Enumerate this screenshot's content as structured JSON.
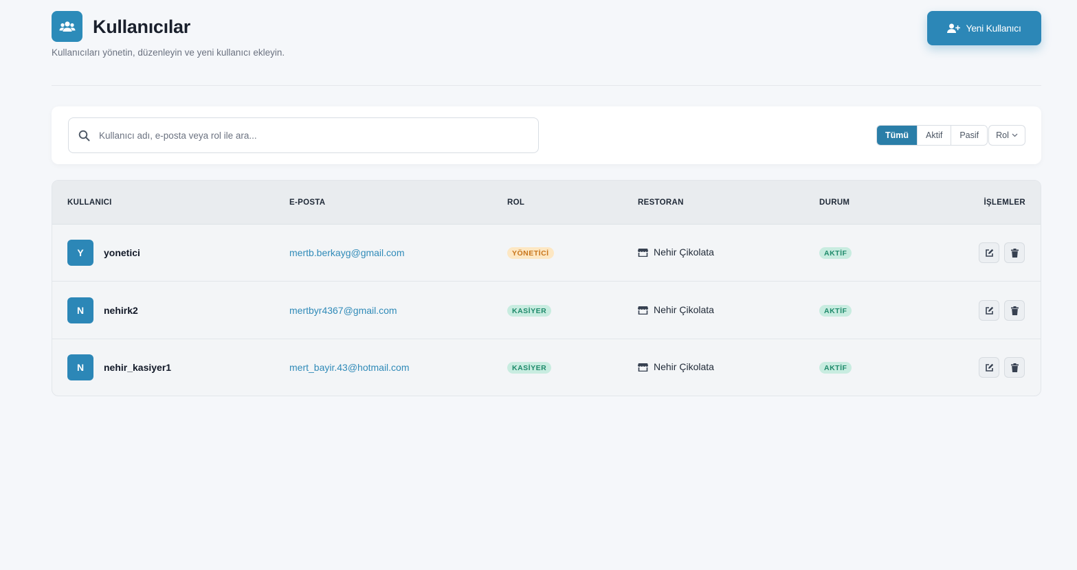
{
  "header": {
    "title": "Kullanıcılar",
    "subtitle": "Kullanıcıları yönetin, düzenleyin ve yeni kullanıcı ekleyin.",
    "icon": "users-icon",
    "new_user_label": "Yeni Kullanıcı"
  },
  "search": {
    "placeholder": "Kullanıcı adı, e-posta veya rol ile ara...",
    "value": ""
  },
  "filters": {
    "status": [
      "Tümü",
      "Aktif",
      "Pasif"
    ],
    "active_status": "Tümü",
    "role_label": "Rol"
  },
  "table": {
    "columns": [
      "KULLANICI",
      "E-POSTA",
      "ROL",
      "RESTORAN",
      "DURUM",
      "İŞLEMLER"
    ],
    "rows": [
      {
        "initial": "Y",
        "username": "yonetici",
        "email": "mertb.berkayg@gmail.com",
        "role": "YÖNETİCİ",
        "restaurant": "Nehir Çikolata",
        "status": "AKTİF"
      },
      {
        "initial": "N",
        "username": "nehirk2",
        "email": "mertbyr4367@gmail.com",
        "role": "KASİYER",
        "restaurant": "Nehir Çikolata",
        "status": "AKTİF"
      },
      {
        "initial": "N",
        "username": "nehir_kasiyer1",
        "email": "mert_bayir.43@hotmail.com",
        "role": "KASİYER",
        "restaurant": "Nehir Çikolata",
        "status": "AKTİF"
      }
    ]
  },
  "colors": {
    "accent": "#2c87b7",
    "admin_badge_bg": "#fde7c3",
    "cashier_badge_bg": "#c8ece0",
    "link": "#2f8ab8"
  }
}
